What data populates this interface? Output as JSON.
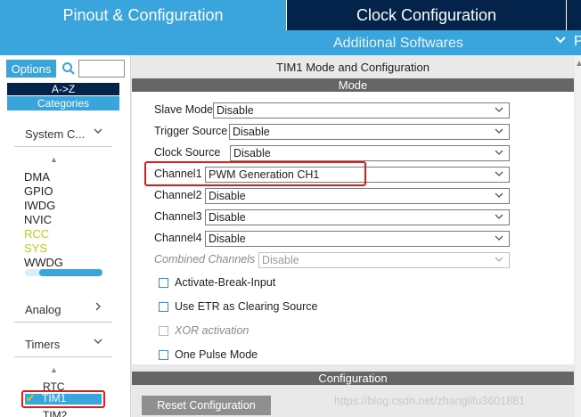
{
  "tabs": {
    "pinout": "Pinout & Configuration",
    "clock": "Clock Configuration",
    "additional": "Additional Softwares"
  },
  "sidebar": {
    "options_label": "Options",
    "sort_label": "A->Z",
    "categories_label": "Categories",
    "system_core": "System C...",
    "system_items": [
      "DMA",
      "GPIO",
      "IWDG",
      "NVIC",
      "RCC",
      "SYS",
      "WWDG"
    ],
    "analog": "Analog",
    "timers": "Timers",
    "timer_items": [
      "RTC",
      "TIM1",
      "TIM2"
    ]
  },
  "main": {
    "title": "TIM1 Mode and Configuration",
    "mode_header": "Mode",
    "fields": [
      {
        "label": "Slave Mode",
        "value": "Disable"
      },
      {
        "label": "Trigger Source",
        "value": "Disable"
      },
      {
        "label": "Clock Source",
        "value": "Disable"
      },
      {
        "label": "Channel1",
        "value": "PWM Generation CH1"
      },
      {
        "label": "Channel2",
        "value": "Disable"
      },
      {
        "label": "Channel3",
        "value": "Disable"
      },
      {
        "label": "Channel4",
        "value": "Disable"
      },
      {
        "label": "Combined Channels",
        "value": "Disable"
      }
    ],
    "checkboxes": [
      "Activate-Break-Input",
      "Use ETR as Clearing Source",
      "XOR activation",
      "One Pulse Mode"
    ],
    "configuration_header": "Configuration",
    "reset_label": "Reset Configuration"
  },
  "watermark": "https://blog.csdn.net/zhanglifu3601881",
  "colors": {
    "accent": "#39a5dc",
    "dark": "#03234b",
    "enabled": "#b9cd1c",
    "highlight": "#e21b1b"
  }
}
